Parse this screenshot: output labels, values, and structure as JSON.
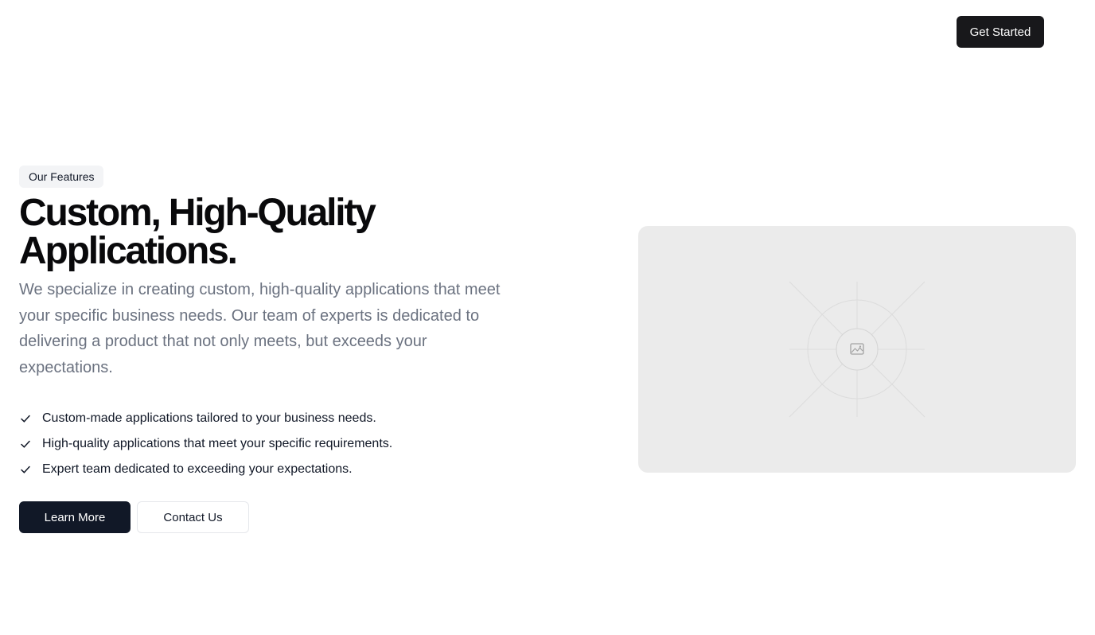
{
  "header": {
    "cta_label": "Get Started"
  },
  "hero": {
    "badge": "Our Features",
    "title_line1": "Custom, High-Quality",
    "title_line2": "Applications.",
    "description": "We specialize in creating custom, high-quality applications that meet your specific business needs. Our team of experts is dedicated to delivering a product that not only meets, but exceeds your expectations.",
    "features": [
      "Custom-made applications tailored to your business needs.",
      "High-quality applications that meet your specific requirements.",
      "Expert team dedicated to exceeding your expectations."
    ],
    "primary_label": "Learn More",
    "secondary_label": "Contact Us"
  },
  "media": {
    "icon": "image-icon"
  },
  "colors": {
    "primary_button": "#111827",
    "header_button": "#18181b",
    "badge_bg": "#f3f4f6",
    "placeholder_bg": "#ebebeb",
    "description_text": "#6b7280"
  }
}
